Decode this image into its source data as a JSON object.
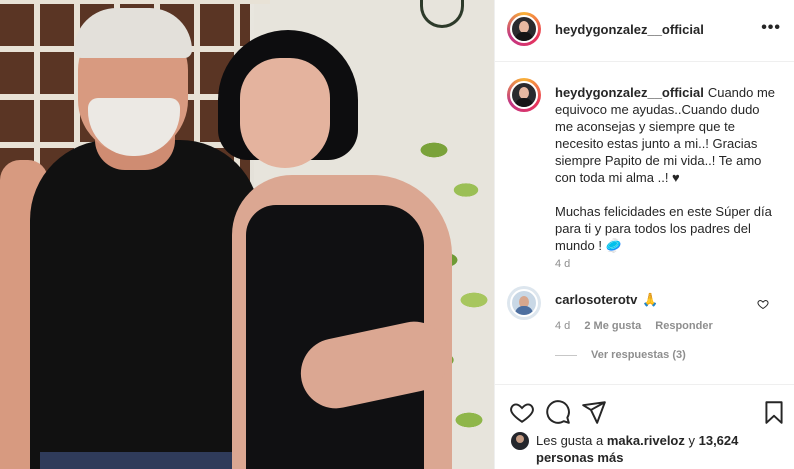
{
  "post": {
    "username": "heydygonzalez__official",
    "more_icon": "more-horizontal-icon",
    "caption_lines": [
      "Cuando me equivoco me ayudas..Cuando dudo me aconsejas y siempre que te necesito estas junto a mi..! Gracias siempre Papito de mi vida..! Te amo con toda mi alma ..! ♥",
      "Muchas felicidades en este Súper día para ti y para todos los padres del mundo ! 🥏"
    ],
    "caption_time": "4 d"
  },
  "comment": {
    "username": "carlosoterotv",
    "emoji": "🙏",
    "time": "4 d",
    "likes": "2 Me gusta",
    "reply_label": "Responder",
    "view_replies": "Ver respuestas (3)"
  },
  "likes": {
    "prefix": "Les gusta a ",
    "user": "maka.riveloz",
    "middle": " y ",
    "count": "13,624 personas más"
  },
  "colors": {
    "text": "#262626",
    "secondary": "#8e8e8e",
    "border": "#efefef"
  },
  "icons": [
    "heart-icon",
    "comment-icon",
    "share-icon",
    "bookmark-icon"
  ]
}
